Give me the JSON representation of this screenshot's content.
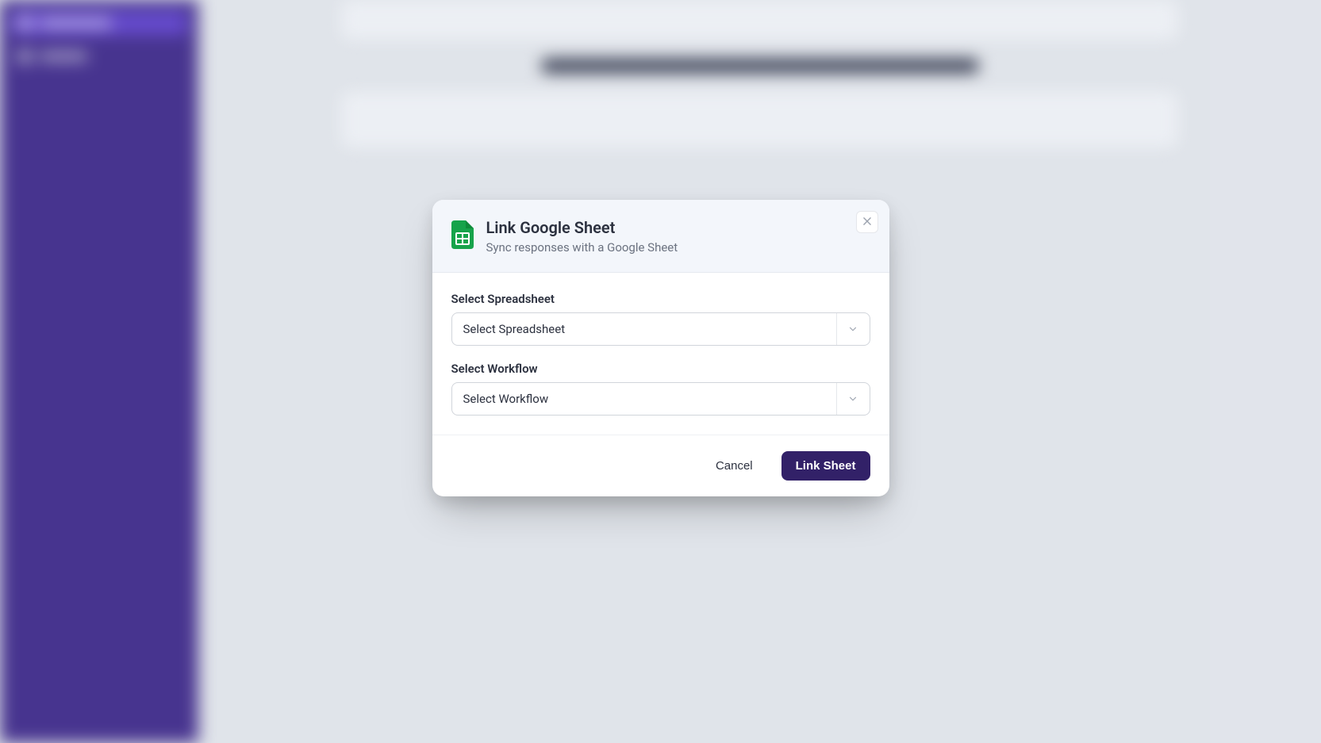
{
  "modal": {
    "title": "Link Google Sheet",
    "subtitle": "Sync responses with a Google Sheet",
    "fields": {
      "spreadsheet": {
        "label": "Select Spreadsheet",
        "placeholder": "Select Spreadsheet"
      },
      "workflow": {
        "label": "Select Workflow",
        "placeholder": "Select Workflow"
      }
    },
    "buttons": {
      "cancel": "Cancel",
      "submit": "Link Sheet"
    }
  },
  "colors": {
    "primary": "#322168",
    "sidebar": "#4a3593",
    "sheets_green": "#16a34a"
  }
}
